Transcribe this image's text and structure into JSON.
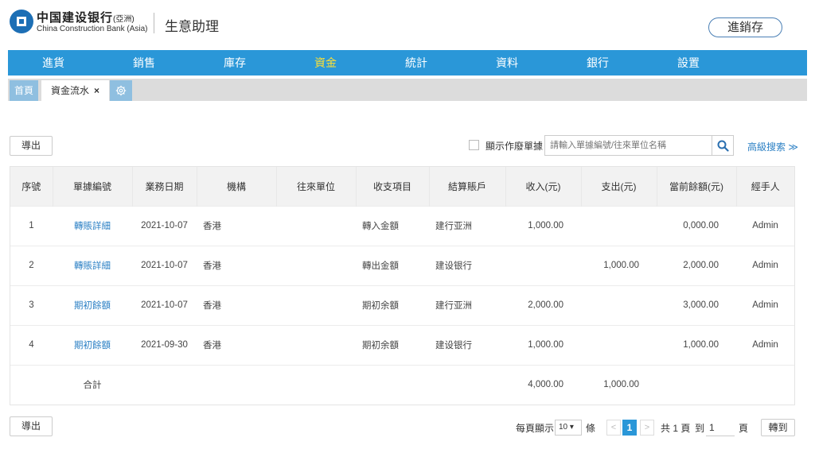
{
  "header": {
    "brand_cn": "中国建设银行",
    "brand_cn_suffix": "(亞洲)",
    "brand_en": "China Construction Bank (Asia)",
    "app_name": "生意助理",
    "inventory_button": "進銷存"
  },
  "nav": {
    "items": [
      "進貨",
      "銷售",
      "庫存",
      "資金",
      "統計",
      "資料",
      "銀行",
      "設置"
    ],
    "active": "資金"
  },
  "tabs": {
    "home": "首頁",
    "cash_flow": "資金流水",
    "close": "×"
  },
  "toolbar": {
    "export_label": "導出",
    "show_void_label": "顯示作廢單據",
    "search_placeholder": "請輸入單據編號/往來單位名稱",
    "advanced_search": "高級搜索 ≫"
  },
  "table": {
    "columns": [
      "序號",
      "單據編號",
      "業務日期",
      "機構",
      "往來單位",
      "收支項目",
      "結算賬戶",
      "收入(元)",
      "支出(元)",
      "當前餘額(元)",
      "經手人"
    ],
    "rows": [
      {
        "no": "1",
        "doc": "轉賬詳細",
        "date": "2021-10-07",
        "org": "香港",
        "partner": "",
        "item": "轉入金額",
        "account": "建行亚洲",
        "income": "1,000.00",
        "expense": "",
        "balance": "0,000.00",
        "handler": "Admin"
      },
      {
        "no": "2",
        "doc": "轉賬詳細",
        "date": "2021-10-07",
        "org": "香港",
        "partner": "",
        "item": "轉出金額",
        "account": "建设银行",
        "income": "",
        "expense": "1,000.00",
        "balance": "2,000.00",
        "handler": "Admin"
      },
      {
        "no": "3",
        "doc": "期初餘額",
        "date": "2021-10-07",
        "org": "香港",
        "partner": "",
        "item": "期初余額",
        "account": "建行亚洲",
        "income": "2,000.00",
        "expense": "",
        "balance": "3,000.00",
        "handler": "Admin"
      },
      {
        "no": "4",
        "doc": "期初餘額",
        "date": "2021-09-30",
        "org": "香港",
        "partner": "",
        "item": "期初余額",
        "account": "建设银行",
        "income": "1,000.00",
        "expense": "",
        "balance": "1,000.00",
        "handler": "Admin"
      }
    ],
    "total": {
      "label": "合計",
      "income": "4,000.00",
      "expense": "1,000.00"
    }
  },
  "footer": {
    "export_label": "導出"
  },
  "pagination": {
    "per_page_label": "每頁顯示",
    "per_page_value": "10 ▾",
    "per_page_unit": "條",
    "prev": "<",
    "current": "1",
    "next": ">",
    "total_label": "共 1 頁",
    "goto_label": "到",
    "goto_value": "1",
    "page_unit": "頁",
    "goto_button": "轉到"
  }
}
